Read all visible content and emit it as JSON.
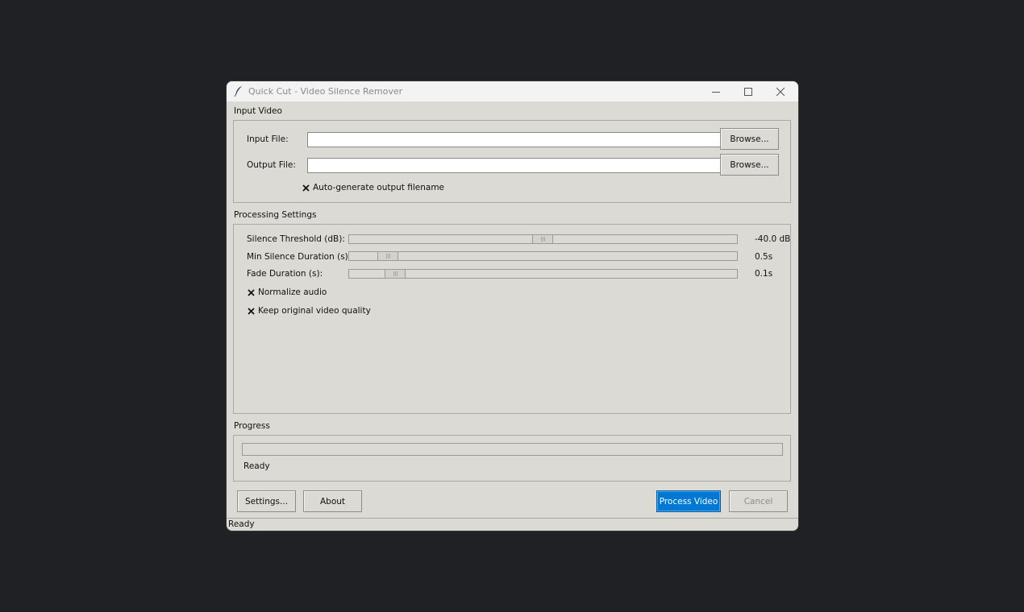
{
  "window": {
    "title": "Quick Cut - Video Silence Remover"
  },
  "input_section": {
    "title": "Input Video",
    "input_label": "Input File:",
    "input_value": "",
    "output_label": "Output File:",
    "output_value": "",
    "browse_label": "Browse...",
    "auto_generate_label": "Auto-generate output filename",
    "auto_generate_checked": true
  },
  "processing_section": {
    "title": "Processing Settings",
    "threshold_label": "Silence Threshold (dB):",
    "threshold_value": "-40.0 dB",
    "min_silence_label": "Min Silence Duration (s):",
    "min_silence_value": "0.5s",
    "fade_label": "Fade Duration (s):",
    "fade_value": "0.1s",
    "normalize_label": "Normalize audio",
    "normalize_checked": true,
    "keep_quality_label": "Keep original video quality",
    "keep_quality_checked": true
  },
  "progress_section": {
    "title": "Progress",
    "progress": 0,
    "status_text": "Ready"
  },
  "buttons": {
    "settings": "Settings...",
    "about": "About",
    "process": "Process Video",
    "cancel": "Cancel"
  },
  "statusbar": {
    "text": "Ready"
  },
  "colors": {
    "accent": "#0078d4",
    "window_bg": "#dcdad5",
    "desktop": "#202124"
  }
}
